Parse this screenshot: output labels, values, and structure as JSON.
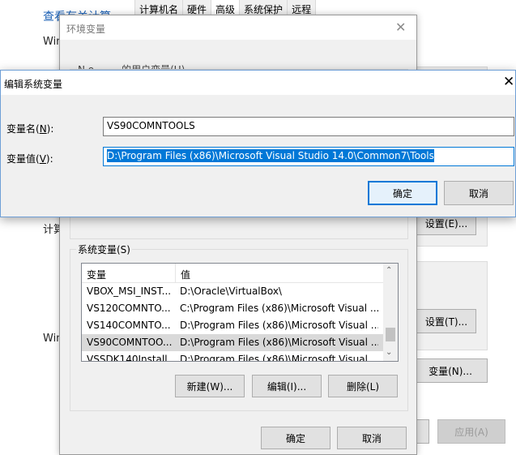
{
  "system_properties": {
    "link_text": "查看有关计算",
    "win_label_1": "Win",
    "computer_label": "计算",
    "win_label_2": "Win",
    "tabs": [
      "计算机名",
      "硬件",
      "高级",
      "系统保护",
      "远程"
    ],
    "settings_button_1": "设置(E)...",
    "settings_button_2": "设置(T)...",
    "env_vars_button": "变量(N)...",
    "apply_button": "应用(A)"
  },
  "env_dialog": {
    "title": "环境变量",
    "user_vars_label": "N o~~~ 的用户变量(U)",
    "system_vars_label": "系统变量(S)",
    "columns": {
      "name": "变量",
      "value": "值"
    },
    "rows": [
      {
        "name": "VBOX_MSI_INST...",
        "value": "D:\\Oracle\\VirtualBox\\"
      },
      {
        "name": "VS120COMNTO...",
        "value": "C:\\Program Files (x86)\\Microsoft Visual ..."
      },
      {
        "name": "VS140COMNTO...",
        "value": "D:\\Program Files (x86)\\Microsoft Visual ..."
      },
      {
        "name": "VS90COMNTOO...",
        "value": "D:\\Program Files (x86)\\Microsoft Visual ..."
      },
      {
        "name": "VSSDK140Install...",
        "value": "D:\\Program Files (x86)\\Microsoft Visual ..."
      }
    ],
    "selected_row": 3,
    "new_button": "新建(W)...",
    "edit_button": "编辑(I)...",
    "delete_button": "删除(L)",
    "ok_button": "确定",
    "cancel_button": "取消"
  },
  "edit_dialog": {
    "title": "编辑系统变量",
    "name_label_text": "变量名(",
    "name_label_key": "N",
    "name_label_end": "):",
    "name_value": "VS90COMNTOOLS",
    "value_label_text": "变量值(",
    "value_label_key": "V",
    "value_label_end": "):",
    "value_value": "D:\\Program Files (x86)\\Microsoft Visual Studio 14.0\\Common7\\Tools",
    "ok_button": "确定",
    "cancel_button": "取消"
  },
  "colors": {
    "accent": "#0078d7",
    "link": "#1a5fb4",
    "dialog_bg": "#f0f0f0"
  },
  "icons": {
    "close": "close-icon",
    "scroll_up": "scroll-up-arrow-icon",
    "scroll_down": "scroll-down-arrow-icon"
  }
}
